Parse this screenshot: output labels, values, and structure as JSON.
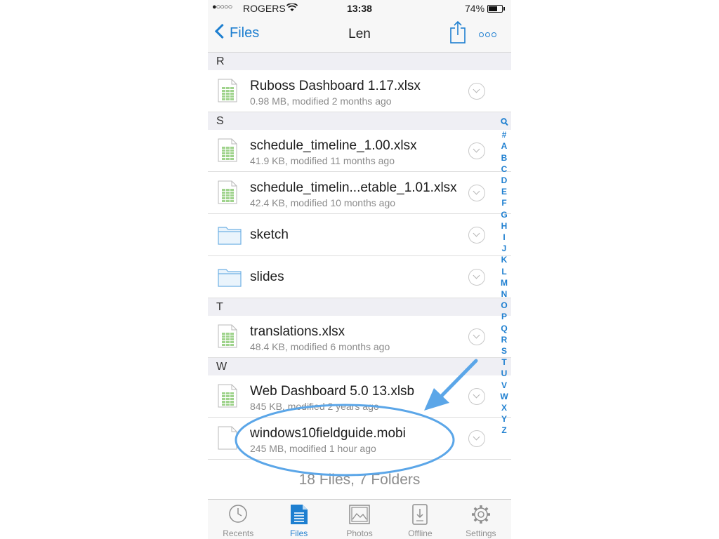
{
  "status": {
    "signal": "●○○○○",
    "carrier": "ROGERS",
    "time": "13:38",
    "battery": "74%",
    "battery_level": 0.74
  },
  "nav": {
    "back_label": "Files",
    "title": "Len"
  },
  "sections": [
    {
      "letter": "R",
      "items": [
        {
          "type": "spreadsheet",
          "name": "Ruboss Dashboard 1.17.xlsx",
          "meta": "0.98 MB, modified 2 months ago"
        }
      ]
    },
    {
      "letter": "S",
      "items": [
        {
          "type": "spreadsheet",
          "name": "schedule_timeline_1.00.xlsx",
          "meta": "41.9 KB, modified 11 months ago"
        },
        {
          "type": "spreadsheet",
          "name": "schedule_timelin...etable_1.01.xlsx",
          "meta": "42.4 KB, modified 10 months ago"
        },
        {
          "type": "folder",
          "name": "sketch",
          "meta": ""
        },
        {
          "type": "folder",
          "name": "slides",
          "meta": ""
        }
      ]
    },
    {
      "letter": "T",
      "items": [
        {
          "type": "spreadsheet",
          "name": "translations.xlsx",
          "meta": "48.4 KB, modified 6 months ago"
        }
      ]
    },
    {
      "letter": "W",
      "items": [
        {
          "type": "spreadsheet",
          "name": "Web Dashboard 5.0 13.xlsb",
          "meta": "845 KB, modified 2 years ago"
        },
        {
          "type": "document",
          "name": "windows10fieldguide.mobi",
          "meta": "245 MB, modified 1 hour ago"
        }
      ]
    }
  ],
  "footer": "18 Files, 7 Folders",
  "index": [
    "search-icon",
    "#",
    "A",
    "B",
    "C",
    "D",
    "E",
    "F",
    "G",
    "H",
    "I",
    "J",
    "K",
    "L",
    "M",
    "N",
    "O",
    "P",
    "Q",
    "R",
    "S",
    "T",
    "U",
    "V",
    "W",
    "X",
    "Y",
    "Z"
  ],
  "tabs": [
    {
      "label": "Recents",
      "icon": "clock-icon",
      "active": false
    },
    {
      "label": "Files",
      "icon": "files-icon",
      "active": true
    },
    {
      "label": "Photos",
      "icon": "photo-icon",
      "active": false
    },
    {
      "label": "Offline",
      "icon": "offline-icon",
      "active": false
    },
    {
      "label": "Settings",
      "icon": "gear-icon",
      "active": false
    }
  ],
  "colors": {
    "accent": "#1e7fd0",
    "annotation": "#5ba6e8",
    "section_bg": "#efeff4",
    "spreadsheet_icon": "#7cc06a"
  }
}
